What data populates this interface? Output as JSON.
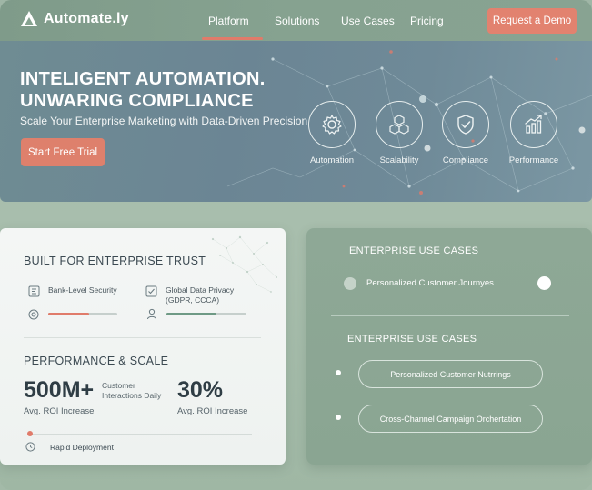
{
  "nav": {
    "brand": "Automate.ly",
    "items": [
      "Platform",
      "Solutions",
      "Use Cases",
      "Pricing"
    ],
    "active_item": "Platform",
    "cta": "Request a Demo"
  },
  "hero": {
    "title_line1": "INTELIGENT AUTOMATION.",
    "title_line2": "UNWARING COMPLIANCE",
    "subtitle": "Scale Your Enterprise Marketing with Data-Driven Precision",
    "cta": "Start Free Trial",
    "features": [
      {
        "label": "Automation",
        "icon": "gear-icon"
      },
      {
        "label": "Scalability",
        "icon": "cubes-icon"
      },
      {
        "label": "Compliance",
        "icon": "shield-check-icon"
      },
      {
        "label": "Performance",
        "icon": "bar-chart-icon"
      }
    ]
  },
  "trust": {
    "title": "BUILT FOR ENTERPRISE TRUST",
    "items": [
      {
        "label": "Bank-Level Security",
        "icon": "security-icon",
        "progress": 0.59
      },
      {
        "label_line1": "Global Data Privacy",
        "label_line2": "(GDPR, CCCA)",
        "icon": "privacy-check-icon",
        "progress": 0.63
      }
    ]
  },
  "performance": {
    "title": "PERFORMANCE & SCALE",
    "metric1": {
      "value": "500M+",
      "note_line1": "Customer",
      "note_line2": "Interactions Daily",
      "caption": "Avg. ROI Increase"
    },
    "metric2": {
      "value": "30%",
      "caption": "Avg. ROI Increase"
    },
    "footer": "Rapid Deployment"
  },
  "use_cases": {
    "title1": "ENTERPRISE USE CASES",
    "item1": "Personalized Customer Journyes",
    "title2": "ENTERPRISE USE CASES",
    "pills": [
      "Personalized Customer Nutrrings",
      "Cross-Channel Campaign Orchertation"
    ]
  },
  "colors": {
    "accent": "#e2826f",
    "nav_bg": "#86a290",
    "hero_bg": "#6b8594",
    "card_green": "#8ea896",
    "text_dark": "#2f3d45"
  }
}
